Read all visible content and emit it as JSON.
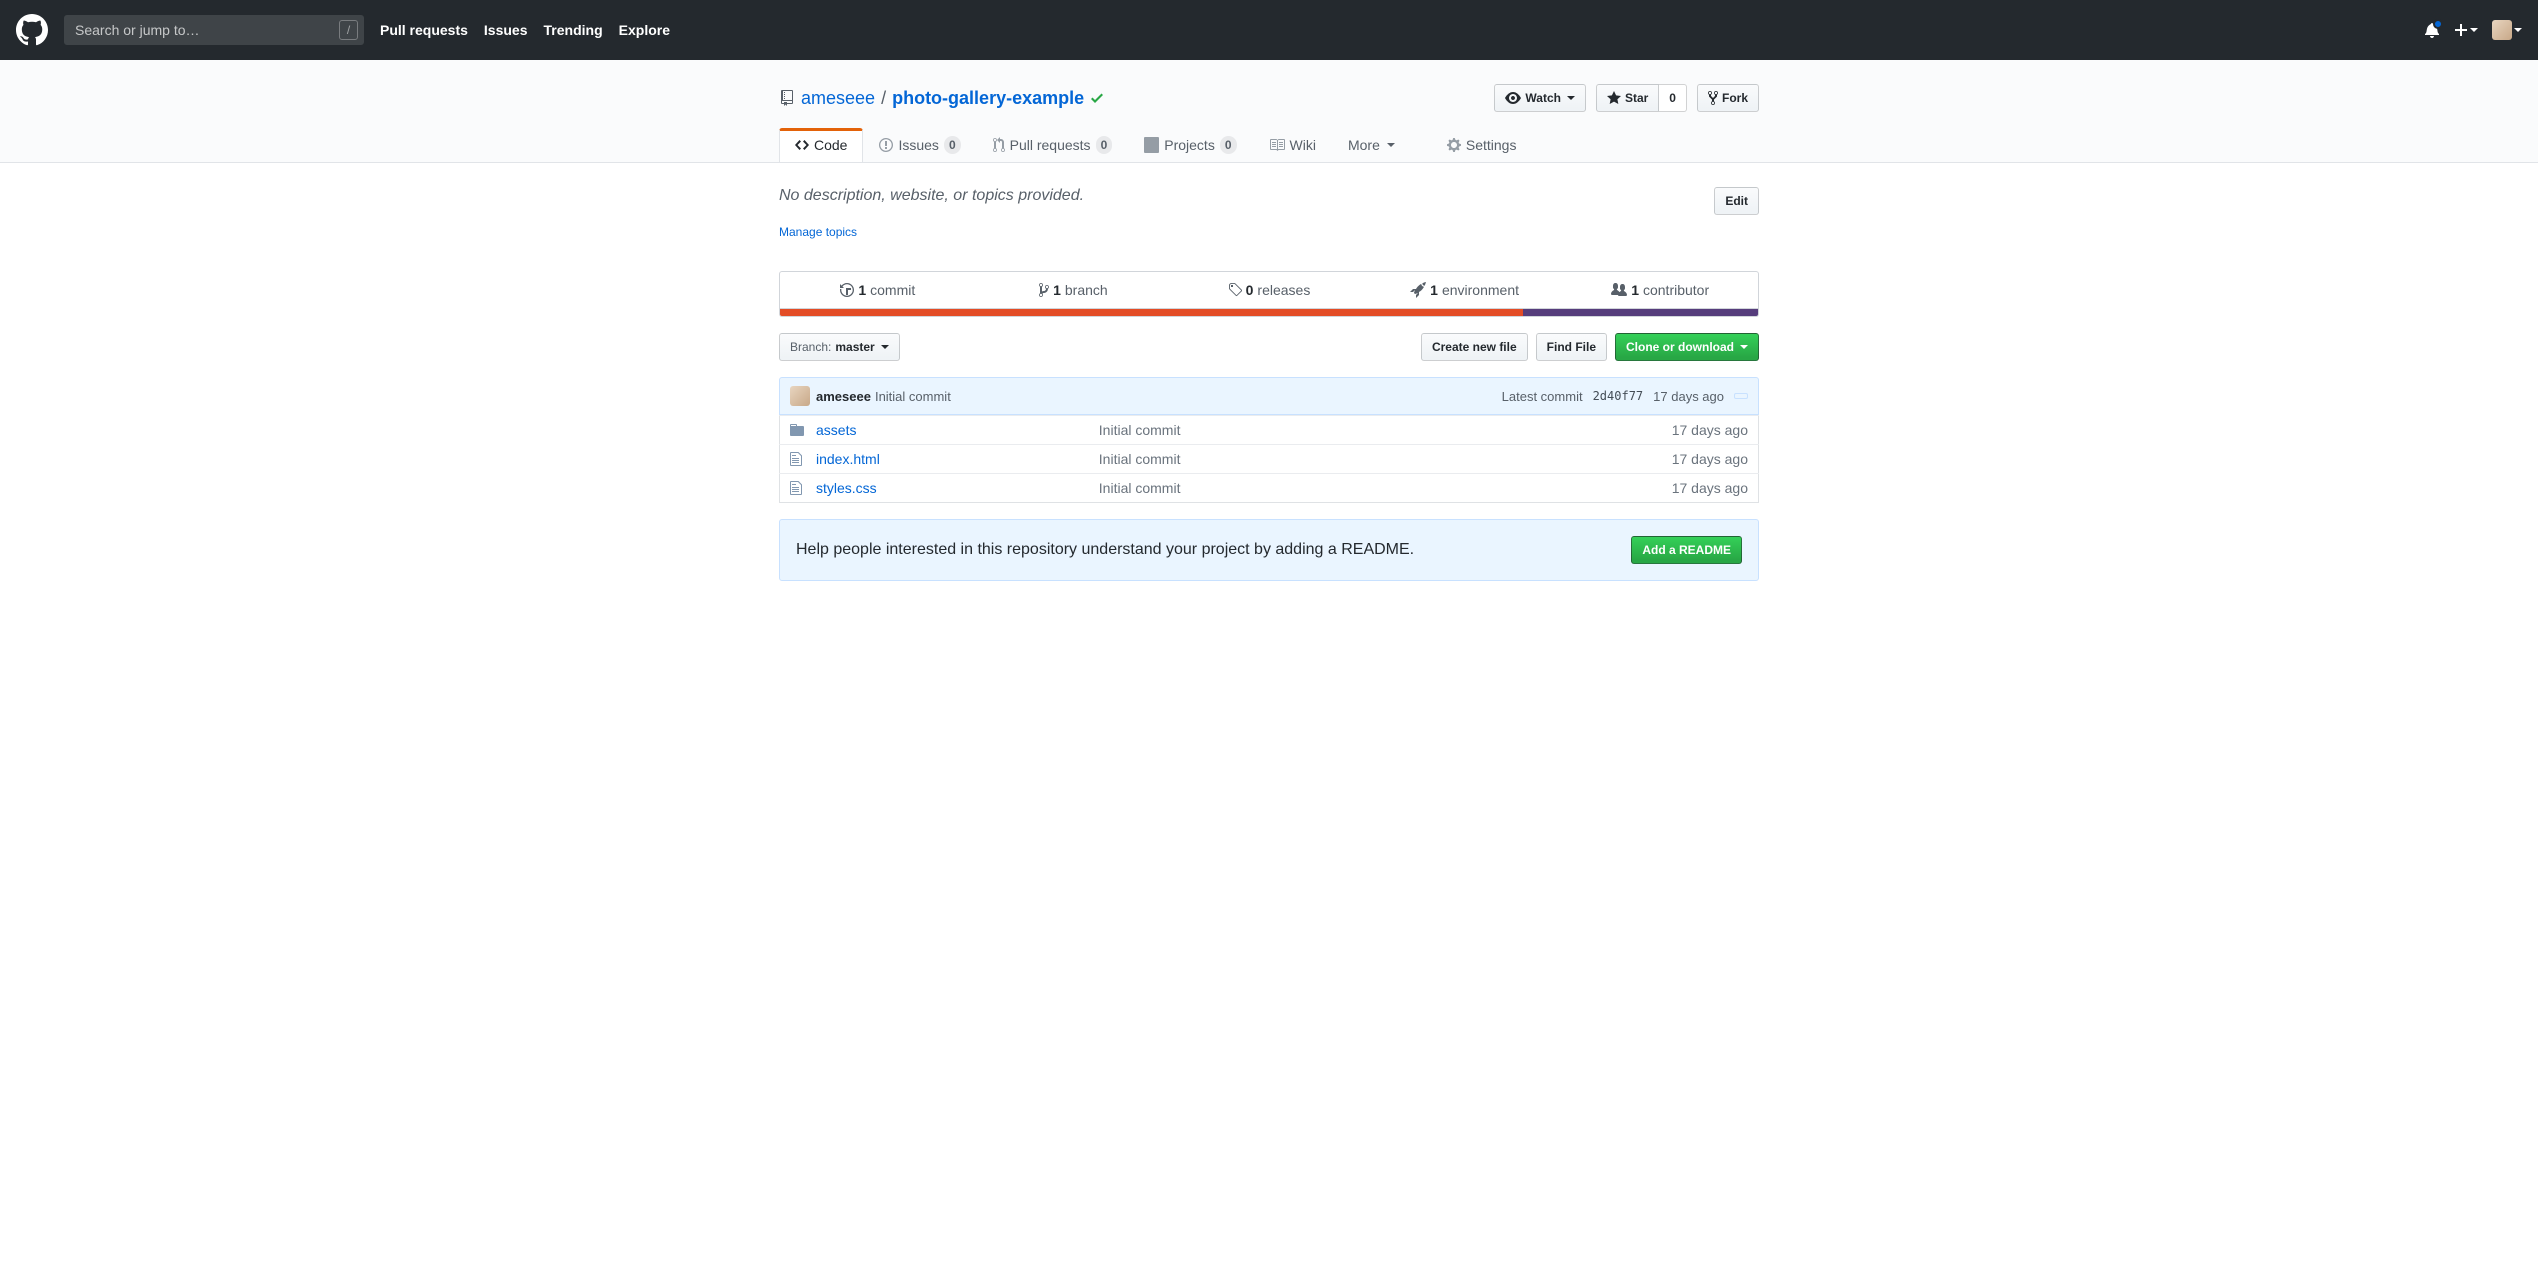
{
  "header": {
    "search_placeholder": "Search or jump to…",
    "nav": [
      "Pull requests",
      "Issues",
      "Trending",
      "Explore"
    ]
  },
  "repo": {
    "owner": "ameseee",
    "name": "photo-gallery-example"
  },
  "actions": {
    "watch": "Watch",
    "star": "Star",
    "star_count": "0",
    "fork": "Fork"
  },
  "tabs": {
    "code": "Code",
    "issues": "Issues",
    "issues_count": "0",
    "pulls": "Pull requests",
    "pulls_count": "0",
    "projects": "Projects",
    "projects_count": "0",
    "wiki": "Wiki",
    "more": "More",
    "settings": "Settings"
  },
  "description": {
    "text": "No description, website, or topics provided.",
    "edit": "Edit",
    "manage": "Manage topics"
  },
  "stats": {
    "commits_n": "1",
    "commits": "commit",
    "branches_n": "1",
    "branches": "branch",
    "releases_n": "0",
    "releases": "releases",
    "env_n": "1",
    "env": "environment",
    "contrib_n": "1",
    "contrib": "contributor"
  },
  "branch": {
    "label": "Branch:",
    "name": "master"
  },
  "filenav": {
    "create": "Create new file",
    "find": "Find File",
    "clone": "Clone or download"
  },
  "tease": {
    "author": "ameseee",
    "msg": "Initial commit",
    "latest": "Latest commit",
    "sha": "2d40f77",
    "age": "17 days ago"
  },
  "files": [
    {
      "type": "dir",
      "name": "assets",
      "msg": "Initial commit",
      "age": "17 days ago"
    },
    {
      "type": "file",
      "name": "index.html",
      "msg": "Initial commit",
      "age": "17 days ago"
    },
    {
      "type": "file",
      "name": "styles.css",
      "msg": "Initial commit",
      "age": "17 days ago"
    }
  ],
  "readme": {
    "text": "Help people interested in this repository understand your project by adding a README.",
    "btn": "Add a README"
  },
  "lang": [
    {
      "color": "#e34c26",
      "width": "76%"
    },
    {
      "color": "#563d7c",
      "width": "24%"
    }
  ]
}
